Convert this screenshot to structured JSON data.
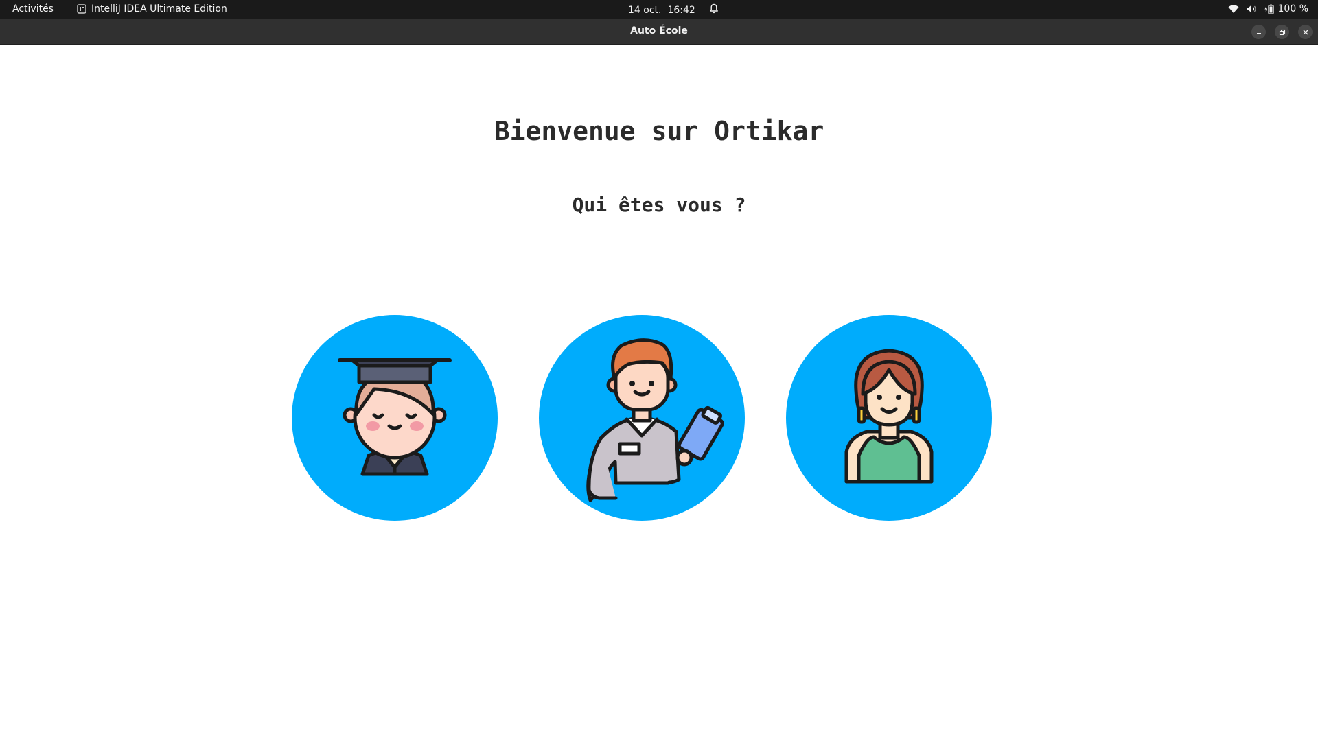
{
  "topbar": {
    "activities": "Activités",
    "app_name": "IntelliJ IDEA Ultimate Edition",
    "date": "14 oct.",
    "time": "16:42",
    "battery": "100 %"
  },
  "window": {
    "title": "Auto École"
  },
  "page": {
    "welcome": "Bienvenue sur Ortikar",
    "question": "Qui êtes vous ?"
  },
  "roles": [
    {
      "icon": "graduate-student-icon"
    },
    {
      "icon": "instructor-clipboard-icon"
    },
    {
      "icon": "woman-avatar-icon"
    }
  ],
  "colors": {
    "circle": "#00acfc",
    "topbar": "#1a1a1a",
    "titlebar": "#303030"
  }
}
